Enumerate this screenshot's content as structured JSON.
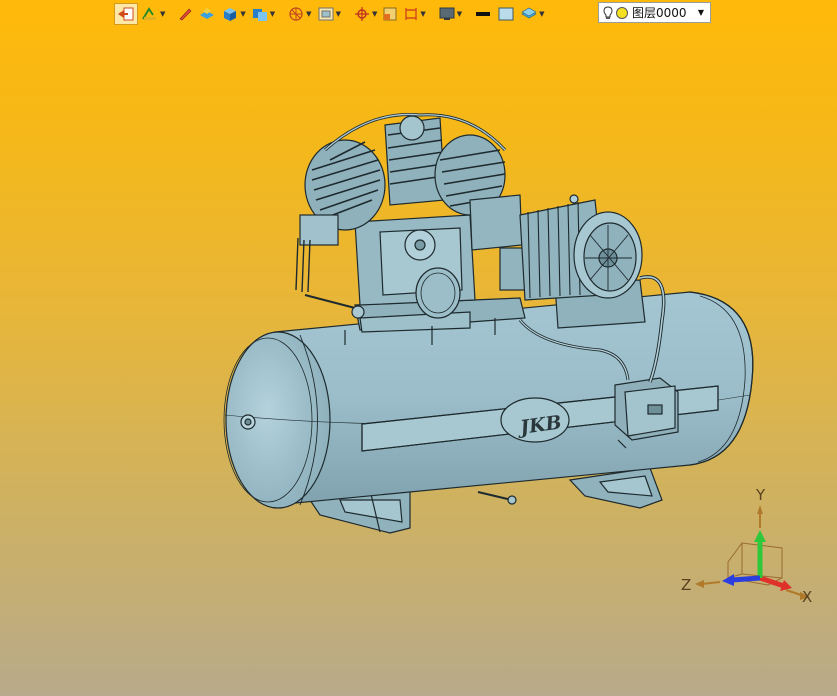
{
  "toolbar": {
    "layer_value": "图层0000"
  },
  "triad": {
    "x_label": "X",
    "y_label": "Y",
    "z_label": "Z"
  },
  "model": {
    "brand_text": "JKB"
  }
}
